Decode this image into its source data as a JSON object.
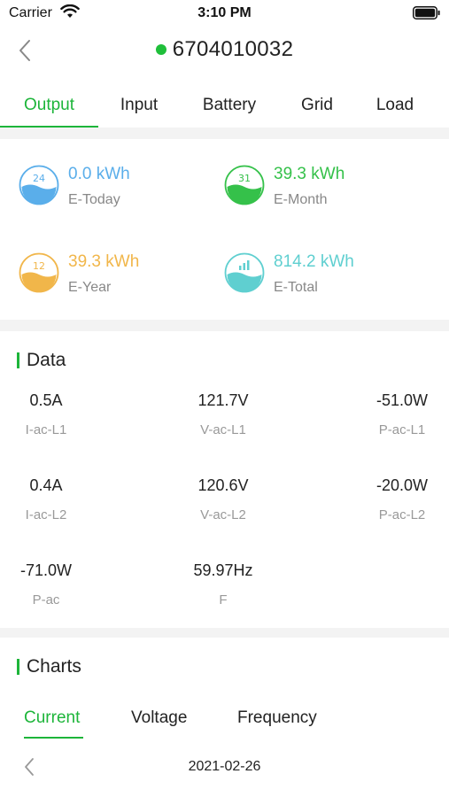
{
  "status_bar": {
    "carrier": "Carrier",
    "time": "3:10 PM"
  },
  "header": {
    "back_icon": "chevron-left-icon",
    "status_color": "#1fbf3a",
    "device_id": "6704010032"
  },
  "tabs": [
    {
      "label": "Output",
      "active": true
    },
    {
      "label": "Input",
      "active": false
    },
    {
      "label": "Battery",
      "active": false
    },
    {
      "label": "Grid",
      "active": false
    },
    {
      "label": "Load",
      "active": false
    }
  ],
  "accent_color": "#1db53a",
  "energy": {
    "today": {
      "icon_number": "24",
      "value": "0.0 kWh",
      "label": "E-Today",
      "color": "#5aaeea"
    },
    "month": {
      "icon_number": "31",
      "value": "39.3 kWh",
      "label": "E-Month",
      "color": "#35c14a"
    },
    "year": {
      "icon_number": "12",
      "value": "39.3 kWh",
      "label": "E-Year",
      "color": "#f1b64a"
    },
    "total": {
      "icon": "bar-chart-icon",
      "value": "814.2 kWh",
      "label": "E-Total",
      "color": "#5fcfd0"
    }
  },
  "data_section": {
    "title": "Data",
    "rows": [
      [
        {
          "value": "0.5A",
          "label": "I-ac-L1"
        },
        {
          "value": "121.7V",
          "label": "V-ac-L1"
        },
        {
          "value": "-51.0W",
          "label": "P-ac-L1"
        }
      ],
      [
        {
          "value": "0.4A",
          "label": "I-ac-L2"
        },
        {
          "value": "120.6V",
          "label": "V-ac-L2"
        },
        {
          "value": "-20.0W",
          "label": "P-ac-L2"
        }
      ],
      [
        {
          "value": "-71.0W",
          "label": "P-ac"
        },
        {
          "value": "59.97Hz",
          "label": "F"
        }
      ]
    ]
  },
  "charts_section": {
    "title": "Charts",
    "tabs": [
      {
        "label": "Current",
        "active": true
      },
      {
        "label": "Voltage",
        "active": false
      },
      {
        "label": "Frequency",
        "active": false
      }
    ],
    "date": "2021-02-26"
  }
}
